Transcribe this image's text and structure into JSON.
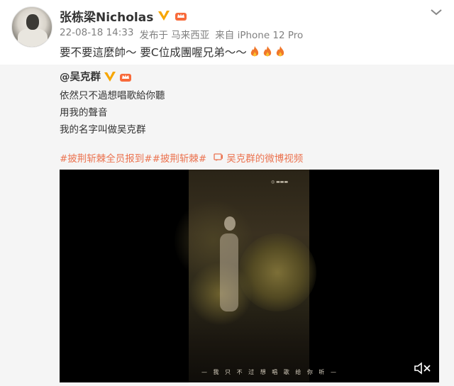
{
  "post": {
    "author": "张栋梁Nicholas",
    "meta_time": "22-08-18 14:33",
    "meta_location": "发布于 马来西亚",
    "meta_device": "来自 iPhone 12 Pro",
    "text": "要不要這麼帥～ 要C位成團喔兄弟～～"
  },
  "repost": {
    "author": "@吴克群",
    "lines": [
      "依然只不過想唱歌給你聽",
      "用我的聲音",
      "我的名字叫做吴克群"
    ],
    "tags": [
      "#披荆斩棘全员报到#",
      "#披荆斩棘#"
    ],
    "video_link": "吴克群的微博视频",
    "video_subtitle": "— 我 只 不 过 想 唱 歌 给 你 听 —"
  },
  "colors": {
    "accent": "#eb7350",
    "badge": "#f7a600",
    "repost_bg": "#f5f5f5"
  },
  "icons": [
    "verified-v-icon",
    "crown-icon",
    "fire-emoji-icon",
    "chevron-down-icon",
    "video-link-icon",
    "mute-icon"
  ]
}
